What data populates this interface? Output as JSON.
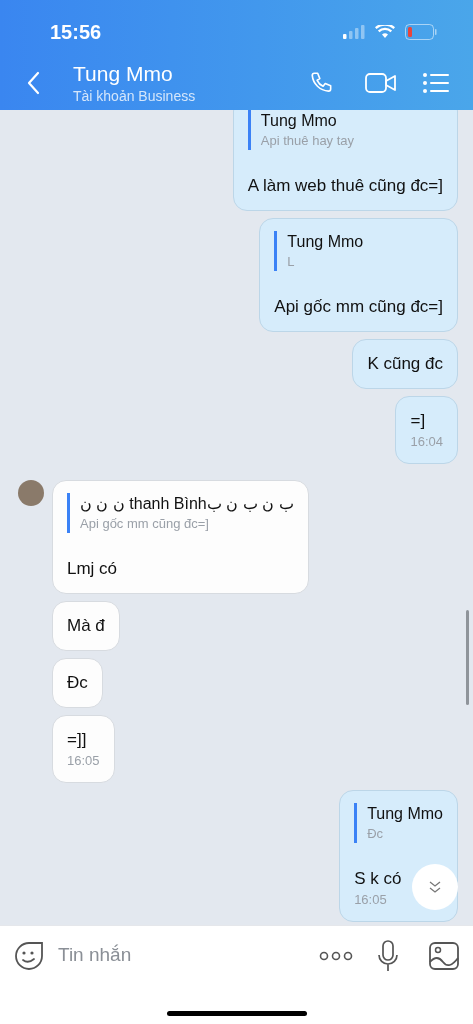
{
  "status_bar": {
    "time": "15:56"
  },
  "header": {
    "title": "Tung Mmo",
    "subtitle": "Tài khoản Business"
  },
  "messages": [
    {
      "kind": "outgoing",
      "quote": {
        "name": "Tung Mmo",
        "text": "Api thuê hay tay"
      },
      "text": "A làm web thuê cũng đc=]"
    },
    {
      "kind": "outgoing",
      "quote": {
        "name": "Tung Mmo",
        "text": "L"
      },
      "text": "Api gốc mm cũng đc=]"
    },
    {
      "kind": "outgoing",
      "text": "K cũng đc"
    },
    {
      "kind": "outgoing",
      "text": "=]",
      "time": "16:04"
    },
    {
      "kind": "incoming",
      "avatar": true,
      "quote": {
        "name": "ن ن ن thanh Bìnhب ن ب ن ب",
        "text": "Api gốc mm cũng đc=]"
      },
      "text": "Lmj có"
    },
    {
      "kind": "incoming",
      "text": "Mà đ"
    },
    {
      "kind": "incoming",
      "text": "Đc"
    },
    {
      "kind": "incoming",
      "text": "=]]",
      "time": "16:05"
    },
    {
      "kind": "outgoing",
      "quote": {
        "name": "Tung Mmo",
        "text": "Đc"
      },
      "text": "S k có",
      "time": "16:05"
    }
  ],
  "composer": {
    "placeholder": "Tin nhắn"
  }
}
